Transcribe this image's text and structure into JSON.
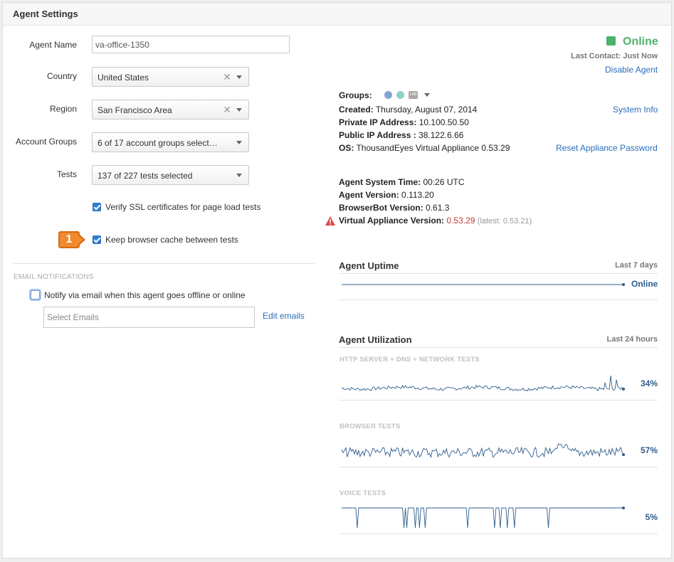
{
  "panel": {
    "title": "Agent Settings"
  },
  "form": {
    "agent_name": {
      "label": "Agent Name",
      "value": "va-office-1350"
    },
    "country": {
      "label": "Country",
      "value": "United States"
    },
    "region": {
      "label": "Region",
      "value": "San Francisco Area"
    },
    "account_groups": {
      "label": "Account Groups",
      "value": "6 of 17 account groups select…"
    },
    "tests": {
      "label": "Tests",
      "value": "137 of 227 tests selected"
    },
    "verify_ssl": {
      "label": "Verify SSL certificates for page load tests",
      "checked": true
    },
    "keep_cache": {
      "label": "Keep browser cache between tests",
      "checked": true
    },
    "callout_number": "1"
  },
  "email": {
    "section": "EMAIL NOTIFICATIONS",
    "notify_label": "Notify via email when this agent goes offline or online",
    "notify_checked": false,
    "select_placeholder": "Select Emails",
    "edit_link": "Edit emails"
  },
  "status": {
    "text": "Online",
    "last_contact": "Last Contact: Just Now",
    "disable_link": "Disable Agent",
    "color": "#4cb46a"
  },
  "info": {
    "groups_label": "Groups:",
    "group_badge": "LAB",
    "created_label": "Created:",
    "created_value": "Thursday, August 07, 2014",
    "private_ip_label": "Private IP Address:",
    "private_ip_value": "10.100.50.50",
    "public_ip_label": "Public IP Address :",
    "public_ip_value": "38.122.6.66",
    "os_label": "OS:",
    "os_value": "ThousandEyes Virtual Appliance 0.53.29",
    "system_info_link": "System Info",
    "reset_link": "Reset Appliance Password",
    "system_time_label": "Agent System Time:",
    "system_time_value": "00:26 UTC",
    "agent_version_label": "Agent Version:",
    "agent_version_value": "0.113.20",
    "browserbot_label": "BrowserBot Version:",
    "browserbot_value": "0.61.3",
    "va_version_label": "Virtual Appliance Version:",
    "va_version_value": "0.53.29",
    "va_latest": "(latest: 0.53.21)"
  },
  "uptime": {
    "title": "Agent Uptime",
    "range": "Last 7 days",
    "status": "Online"
  },
  "utilization": {
    "title": "Agent Utilization",
    "range": "Last 24 hours",
    "charts": [
      {
        "caption": "HTTP SERVER + DNS + NETWORK TESTS",
        "percent": "34%"
      },
      {
        "caption": "BROWSER TESTS",
        "percent": "57%"
      },
      {
        "caption": "VOICE TESTS",
        "percent": "5%"
      }
    ]
  },
  "colors": {
    "accent": "#2a6fba",
    "warning": "#d94b4b",
    "chart_line": "#2f5d8e"
  }
}
